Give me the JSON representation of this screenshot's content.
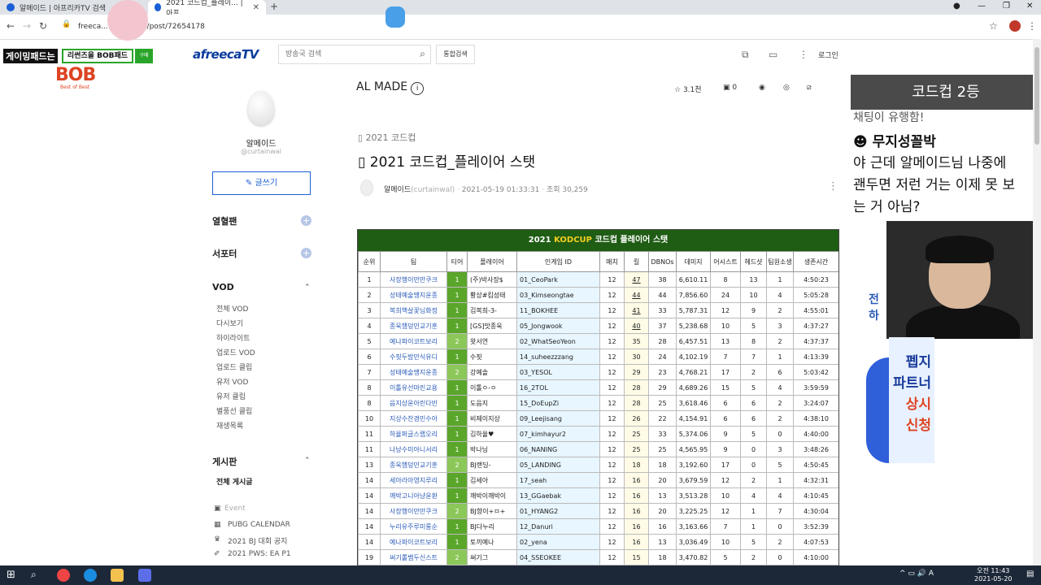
{
  "browser": {
    "tabs": [
      {
        "label": "알메이드 | 아프리카TV 검색"
      },
      {
        "label": "2021 코드컵_플레이... | 아프..."
      }
    ],
    "url": "freeca... urtain.wal/post/72654178",
    "new_tab": "+"
  },
  "header": {
    "logo": "afreecaTV",
    "search_placeholder": "방송국 검색",
    "unified_search": "통합검색",
    "login": "로그인"
  },
  "stream_overlay": {
    "left_tag": "게이밍패드는",
    "bob_pad": "리썬즈을 BOB패드",
    "buy": "구매",
    "bob_logo": "BOB",
    "bob_sub": "Best of Best",
    "head": "코드컵 2등",
    "chat_partial": "채팅이 유행함!",
    "chat_user": "무지성꼴박",
    "chat_lines": [
      "야 근데 알메이드님 나중에",
      "괜두면 저런 거는 이제 못 보",
      "는 거 아님?"
    ],
    "side_text": [
      "전",
      "하"
    ],
    "promo_lines": [
      "펩지",
      "파트너",
      "상시",
      "신청"
    ]
  },
  "sidebar": {
    "name": "알메이드",
    "id": "@curtainwal",
    "write": "글쓰기",
    "fans": "열혈팬",
    "supporters": "서포터",
    "vod": "VOD",
    "vod_items": [
      "전체 VOD",
      "다시보기",
      "하이라이트",
      "업로드 VOD",
      "업로드 클립",
      "유저 VOD",
      "유저 클립",
      "별풍선 클립",
      "재생목록"
    ],
    "board": "게시판",
    "board_all": "전체 게시글",
    "board_items": [
      "Event",
      "PUBG CALENDAR",
      "2021 BJ 대회 공지",
      "2021 PWS: EA P1"
    ]
  },
  "post": {
    "channel": "AL MADE",
    "likes": "3.1천",
    "comments": "0",
    "category": "2021 코드컵",
    "title": "2021 코드컵_플레이어 스탯",
    "author": "알메이드",
    "author_id": "(curtainwal)",
    "date": "2021-05-19 01:33:31",
    "views": "조회 30,259"
  },
  "stats_table": {
    "title_prefix": "2021 ",
    "title_highlight": "KODCUP",
    "title_suffix": " 코드컵 플레이어 스탯",
    "headers": [
      "순위",
      "팀",
      "티어",
      "플레이어",
      "인게임 ID",
      "매치",
      "킬",
      "DBNOs",
      "데미지",
      "어시스트",
      "헤드샷",
      "팀원소생",
      "생존시간"
    ],
    "rows": [
      [
        "1",
        "사장행이만만쿠크",
        "1",
        "(주)박사장$",
        "01_CeoPark",
        "12",
        "47",
        "38",
        "6,610.11",
        "8",
        "13",
        "1",
        "4:50:23"
      ],
      [
        "2",
        "성태예술땡지윤종",
        "1",
        "황상#킴성태",
        "03_Kimseongtae",
        "12",
        "44",
        "44",
        "7,856.60",
        "24",
        "10",
        "4",
        "5:05:28"
      ],
      [
        "3",
        "복희핵살꽃님화정",
        "1",
        "김복희-3-",
        "11_BOKHEE",
        "12",
        "41",
        "33",
        "5,787.31",
        "12",
        "9",
        "2",
        "4:55:01"
      ],
      [
        "4",
        "종욱햄덩민교기훈",
        "1",
        "[GS]맛종욱",
        "05_Jongwook",
        "12",
        "40",
        "37",
        "5,238.68",
        "10",
        "5",
        "3",
        "4:37:27"
      ],
      [
        "5",
        "예나파이코트보리",
        "2",
        "왓서연",
        "02_WhatSeoYeon",
        "12",
        "35",
        "28",
        "6,457.51",
        "13",
        "8",
        "2",
        "4:37:37"
      ],
      [
        "6",
        "수핏두밤만식유디",
        "1",
        "수핏",
        "14_suheezzzang",
        "12",
        "30",
        "24",
        "4,102.19",
        "7",
        "7",
        "1",
        "4:13:39"
      ],
      [
        "7",
        "성태예술땡지윤종",
        "2",
        "강예솔",
        "03_YESOL",
        "12",
        "29",
        "23",
        "4,768.21",
        "17",
        "2",
        "6",
        "5:03:42"
      ],
      [
        "8",
        "이톨유선마린교용",
        "1",
        "이톨ㅇ-ㅇ",
        "16_2TOL",
        "12",
        "28",
        "29",
        "4,689.26",
        "15",
        "5",
        "4",
        "3:59:59"
      ],
      [
        "8",
        "읍지상윤아린다빈",
        "1",
        "도읍지",
        "15_DoEupZi",
        "12",
        "28",
        "25",
        "3,618.46",
        "6",
        "6",
        "2",
        "3:24:07"
      ],
      [
        "10",
        "지상수찬경민수아",
        "1",
        "비제이지상",
        "09_Leejisang",
        "12",
        "26",
        "22",
        "4,154.91",
        "6",
        "6",
        "2",
        "4:38:10"
      ],
      [
        "11",
        "하율퍼글스랩오리",
        "1",
        "김하율♥",
        "07_kimhayur2",
        "12",
        "25",
        "33",
        "5,374.06",
        "9",
        "5",
        "0",
        "4:40:00"
      ],
      [
        "11",
        "나낭수미아니서리",
        "1",
        "박나닝",
        "06_NANING",
        "12",
        "25",
        "25",
        "4,565.95",
        "9",
        "0",
        "3",
        "3:48:26"
      ],
      [
        "13",
        "종욱햄덩민교기훈",
        "2",
        "BJ랜딩-",
        "05_LANDING",
        "12",
        "18",
        "18",
        "3,192.60",
        "17",
        "0",
        "5",
        "4:50:45"
      ],
      [
        "14",
        "세아라아영지루리",
        "1",
        "김세아",
        "17_seah",
        "12",
        "16",
        "20",
        "3,679.59",
        "12",
        "2",
        "1",
        "4:32:31"
      ],
      [
        "14",
        "깨박고니아냥윤환",
        "1",
        "깨박이깨박이",
        "13_GGaebak",
        "12",
        "16",
        "13",
        "3,513.28",
        "10",
        "4",
        "4",
        "4:10:45"
      ],
      [
        "14",
        "사장행이만만쿠크",
        "2",
        "BJ향이+ㅁ+",
        "01_HYANG2",
        "12",
        "16",
        "20",
        "3,225.25",
        "12",
        "1",
        "7",
        "4:30:04"
      ],
      [
        "14",
        "누리유주루미롱순",
        "1",
        "BJ다누리",
        "12_Danuri",
        "12",
        "16",
        "16",
        "3,163.66",
        "7",
        "1",
        "0",
        "3:52:39"
      ],
      [
        "14",
        "예나파이코트보리",
        "1",
        "토끼예나",
        "02_yena",
        "12",
        "16",
        "13",
        "3,036.49",
        "10",
        "5",
        "2",
        "4:07:53"
      ],
      [
        "19",
        "써기롤뱀두신스트",
        "2",
        "써기그",
        "04_SSEOKEE",
        "12",
        "15",
        "18",
        "3,470.82",
        "5",
        "2",
        "0",
        "4:10:00"
      ]
    ]
  },
  "taskbar": {
    "time": "오전 11:43",
    "date": "2021-05-20"
  }
}
